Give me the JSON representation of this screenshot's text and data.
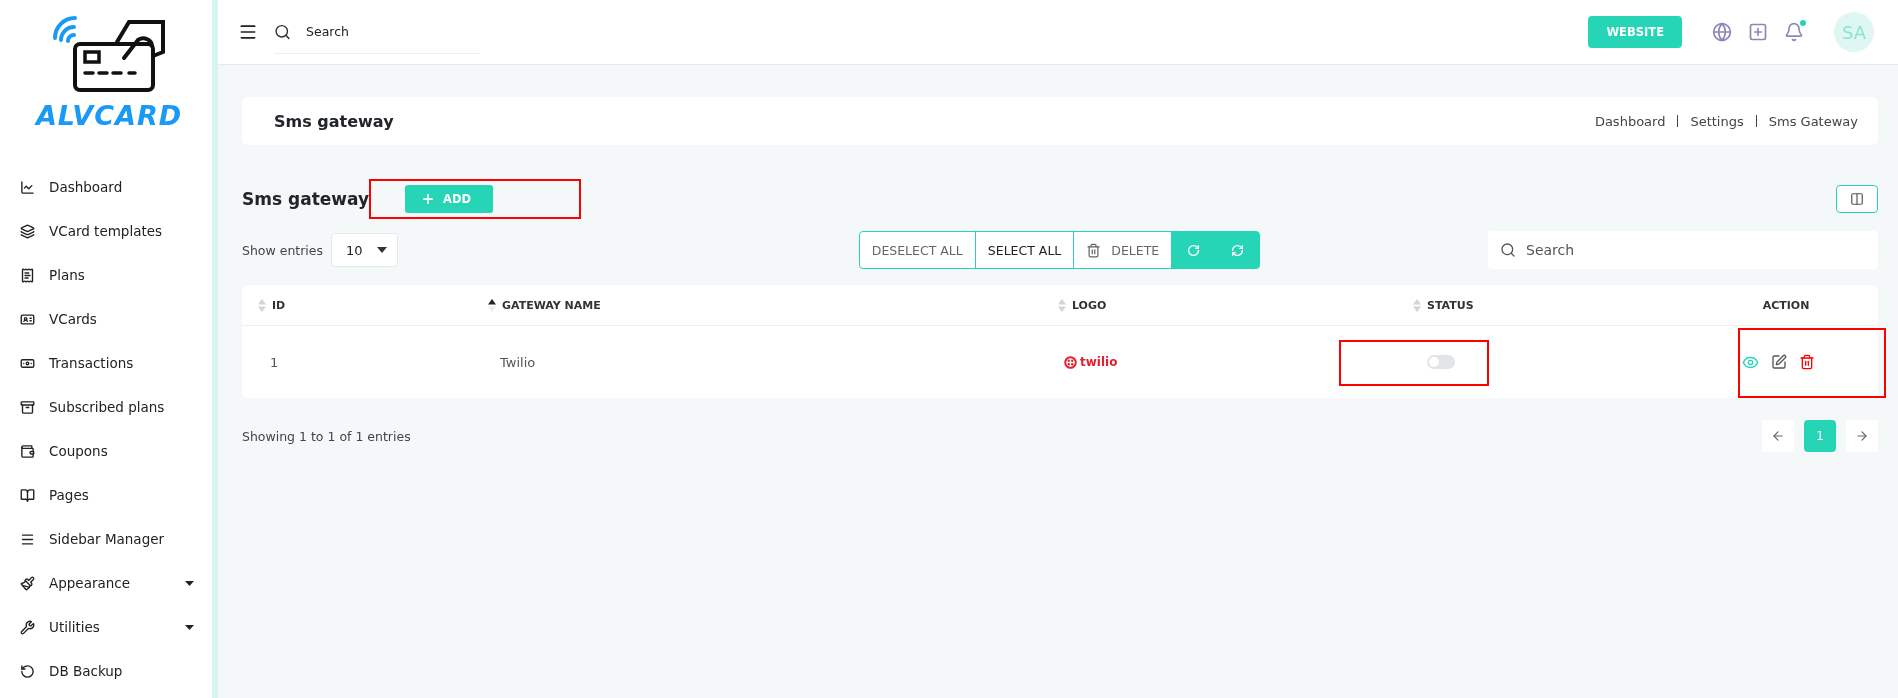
{
  "brand": {
    "name": "ALVCARD"
  },
  "sidebar": {
    "items": [
      {
        "label": "Dashboard",
        "expandable": false
      },
      {
        "label": "VCard templates",
        "expandable": false
      },
      {
        "label": "Plans",
        "expandable": false
      },
      {
        "label": "VCards",
        "expandable": false
      },
      {
        "label": "Transactions",
        "expandable": false
      },
      {
        "label": "Subscribed plans",
        "expandable": false
      },
      {
        "label": "Coupons",
        "expandable": false
      },
      {
        "label": "Pages",
        "expandable": false
      },
      {
        "label": "Sidebar Manager",
        "expandable": false
      },
      {
        "label": "Appearance",
        "expandable": true
      },
      {
        "label": "Utilities",
        "expandable": true
      },
      {
        "label": "DB Backup",
        "expandable": false
      }
    ]
  },
  "header": {
    "search": {
      "placeholder": "Search"
    },
    "website_button": "WEBSITE",
    "notification_dot": true,
    "avatar": "SA"
  },
  "page_header": {
    "title": "Sms gateway",
    "breadcrumbs": [
      "Dashboard",
      "Settings",
      "Sms Gateway"
    ]
  },
  "section": {
    "title": "Sms gateway",
    "add_button": "ADD",
    "add_highlighted": true
  },
  "toolbar": {
    "show_entries_label": "Show entries",
    "entries_value": "10",
    "bulk_buttons": [
      "DESELECT ALL",
      "SELECT ALL",
      "DELETE"
    ],
    "search": {
      "placeholder": "Search"
    }
  },
  "table": {
    "columns": [
      {
        "label": "ID",
        "sortable": true,
        "sorted": false
      },
      {
        "label": "GATEWAY NAME",
        "sortable": true,
        "sorted": true
      },
      {
        "label": "LOGO",
        "sortable": true,
        "sorted": false
      },
      {
        "label": "STATUS",
        "sortable": true,
        "sorted": false
      },
      {
        "label": "ACTION",
        "sortable": false
      }
    ],
    "rows": [
      {
        "id": "1",
        "name": "Twilio",
        "logo": "twilio",
        "on": false,
        "status_highlighted": true,
        "actions_highlighted": true
      }
    ]
  },
  "footer": {
    "summary": "Showing 1 to 1 of 1 entries",
    "pages": [
      {
        "label": "1",
        "selected": true
      }
    ]
  }
}
